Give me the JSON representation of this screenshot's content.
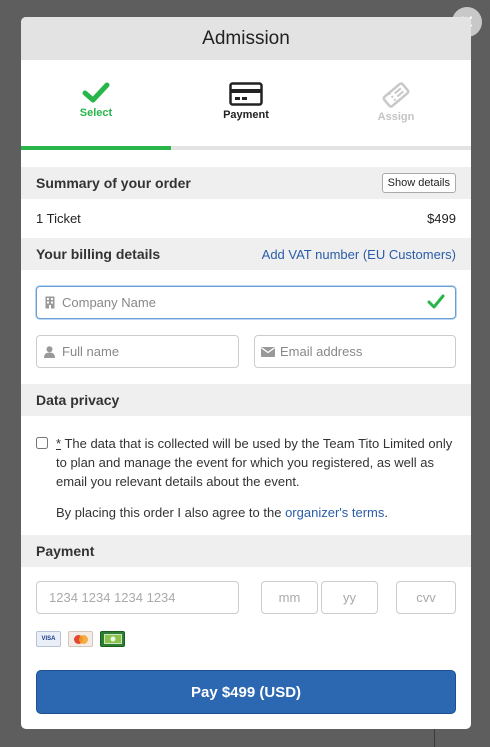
{
  "modal": {
    "title": "Admission",
    "close_icon": "close-icon"
  },
  "steps": [
    {
      "label": "Select",
      "icon": "checkmark-icon",
      "state": "complete"
    },
    {
      "label": "Payment",
      "icon": "credit-card-icon",
      "state": "current"
    },
    {
      "label": "Assign",
      "icon": "ticket-icon",
      "state": "disabled"
    }
  ],
  "progress": {
    "value": 0.333
  },
  "summary": {
    "title": "Summary of your order",
    "show_details_label": "Show details",
    "item_label": "1 Ticket",
    "item_price": "$499"
  },
  "billing": {
    "title": "Your billing details",
    "vat_link": "Add VAT number (EU Customers)",
    "company_placeholder": "Company Name",
    "fullname_placeholder": "Full name",
    "email_placeholder": "Email address"
  },
  "privacy": {
    "title": "Data privacy",
    "asterisk": "*",
    "consent_text": " The data that is collected will be used by the Team Tito Limited only to plan and manage the event for which you registered, as well as email you relevant details about the event.",
    "agree_prefix": "By placing this order I also agree to the ",
    "terms_link": "organizer's terms",
    "agree_suffix": "."
  },
  "payment": {
    "title": "Payment",
    "card_placeholder": "1234 1234 1234 1234",
    "mm_placeholder": "mm",
    "yy_placeholder": "yy",
    "cvv_placeholder": "cvv",
    "brands": [
      "VISA",
      "mastercard",
      "cash"
    ]
  },
  "pay_button": {
    "label": "Pay $499 (USD)"
  },
  "colors": {
    "accent_green": "#28b54a",
    "primary_blue": "#2c67b1",
    "link_blue": "#2a5da8"
  }
}
